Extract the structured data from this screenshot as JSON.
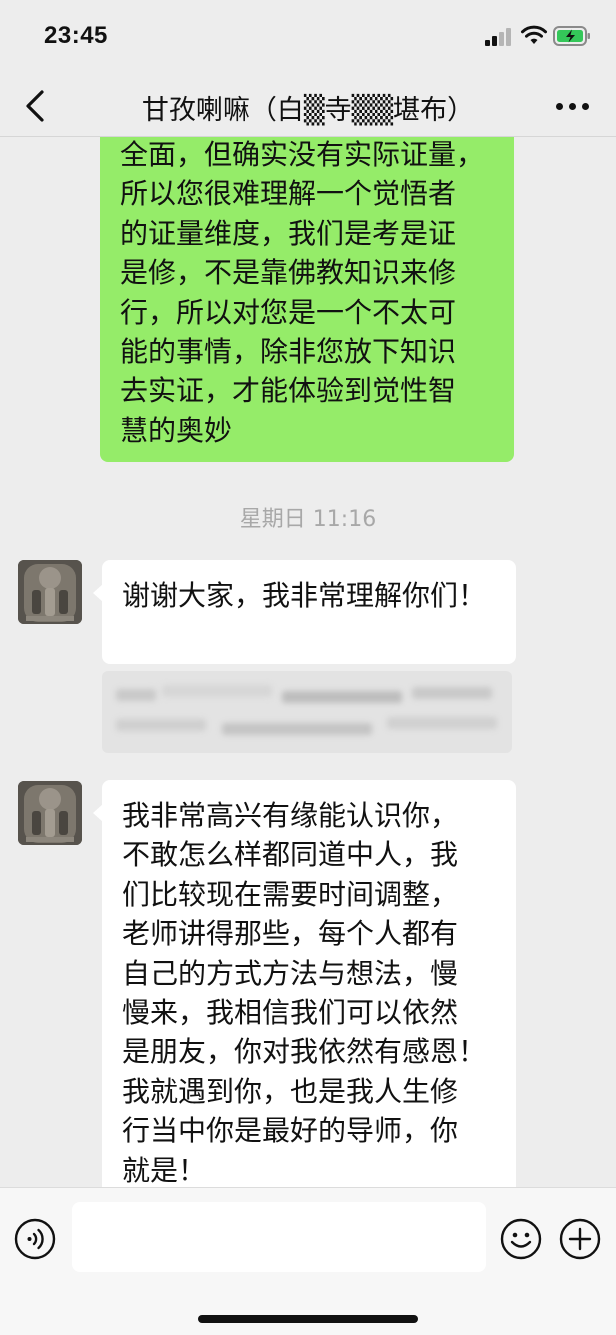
{
  "status_bar": {
    "time": "23:45"
  },
  "nav": {
    "title": "甘孜喇嘛（白▒寺▒▒堪布）"
  },
  "messages": {
    "outgoing_1": "全面，但确实没有实际证量，\n所以您很难理解一个觉悟者\n的证量维度，我们是考是证\n是修，不是靠佛教知识来修\n行，所以对您是一个不太可\n能的事情，除非您放下知识\n去实证，才能体验到觉性智\n慧的奥妙",
    "timestamp": "星期日 11:16",
    "incoming_1": "谢谢大家，我非常理解你们！",
    "incoming_2": "我非常高兴有缘能认识你，\n不敢怎么样都同道中人，我\n们比较现在需要时间调整，\n老师讲得那些，每个人都有\n自己的方式方法与想法，慢\n慢来，我相信我们可以依然\n是朋友，你对我依然有感恩！\n我就遇到你，也是我人生修\n行当中你是最好的导师，你\n就是！"
  },
  "input": {
    "value": ""
  },
  "icons": {
    "back": "chevron-left-icon",
    "more": "more-dots-icon",
    "voice": "voice-icon",
    "emoji": "emoji-icon",
    "plus": "plus-icon"
  },
  "colors": {
    "outgoing_bubble": "#95ec69",
    "incoming_bubble": "#ffffff",
    "background": "#ededed"
  }
}
